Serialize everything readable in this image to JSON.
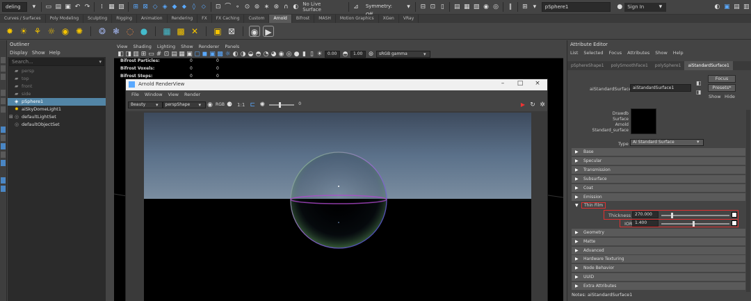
{
  "status_line": {
    "menu_set": "deling",
    "live_surface": "No Live Surface",
    "symmetry": "Symmetry: Off",
    "search_value": "pSphere1",
    "sign_in": "Sign In"
  },
  "shelf_tabs": [
    {
      "label": "Curves / Surfaces",
      "active": false
    },
    {
      "label": "Poly Modeling",
      "active": false
    },
    {
      "label": "Sculpting",
      "active": false
    },
    {
      "label": "Rigging",
      "active": false
    },
    {
      "label": "Animation",
      "active": false
    },
    {
      "label": "Rendering",
      "active": false
    },
    {
      "label": "FX",
      "active": false
    },
    {
      "label": "FX Caching",
      "active": false
    },
    {
      "label": "Custom",
      "active": false
    },
    {
      "label": "Arnold",
      "active": true
    },
    {
      "label": "Bifrost",
      "active": false
    },
    {
      "label": "MASH",
      "active": false
    },
    {
      "label": "Motion Graphics",
      "active": false
    },
    {
      "label": "XGen",
      "active": false
    },
    {
      "label": "VRay",
      "active": false
    }
  ],
  "outliner": {
    "title": "Outliner",
    "menu": [
      "Display",
      "Show",
      "Help"
    ],
    "search_placeholder": "Search...",
    "items": [
      {
        "label": "persp",
        "state": "dim",
        "expander": ""
      },
      {
        "label": "top",
        "state": "dim",
        "expander": ""
      },
      {
        "label": "front",
        "state": "dim",
        "expander": ""
      },
      {
        "label": "side",
        "state": "dim",
        "expander": ""
      },
      {
        "label": "pSphere1",
        "state": "selected",
        "expander": ""
      },
      {
        "label": "aiSkyDomeLight1",
        "state": "lit",
        "expander": ""
      },
      {
        "label": "defaultLightSet",
        "state": "lit",
        "expander": "⊞"
      },
      {
        "label": "defaultObjectSet",
        "state": "lit",
        "expander": ""
      }
    ]
  },
  "viewport": {
    "menu": [
      "View",
      "Shading",
      "Lighting",
      "Show",
      "Renderer",
      "Panels"
    ],
    "exposure": "0.00",
    "gamma": "1.00",
    "color_space": "sRGB gamma",
    "hud": [
      {
        "label": "Bifrost Particles:",
        "v1": "0",
        "v2": "0"
      },
      {
        "label": "Bifrost Voxels:",
        "v1": "0",
        "v2": "0"
      },
      {
        "label": "Bifrost Steps:",
        "v1": "0",
        "v2": "0"
      }
    ]
  },
  "render_view": {
    "title": "Arnold RenderView",
    "menu": [
      "File",
      "Window",
      "View",
      "Render"
    ],
    "aov": "Beauty",
    "camera": "perspShape",
    "ratio": "1:1",
    "exposure": "0"
  },
  "attribute_editor": {
    "title": "Attribute Editor",
    "menu": [
      "List",
      "Selected",
      "Focus",
      "Attributes",
      "Show",
      "Help"
    ],
    "tabs": [
      {
        "label": "pSphereShape1",
        "active": false
      },
      {
        "label": "polySmoothFace1",
        "active": false
      },
      {
        "label": "polySphere1",
        "active": false
      },
      {
        "label": "aiStandardSurface1",
        "active": true
      }
    ],
    "node_type_label": "aiStandardSurface:",
    "node_name": "aiStandardSurface1",
    "focus_button": "Focus",
    "presets_button": "Presets*",
    "show_button": "Show",
    "hide_button": "Hide",
    "swatch_caption": [
      "Drawdb",
      "Surface",
      "Arnold",
      "Standard_surface"
    ],
    "type_label": "Type",
    "type_value": "Ai Standard Surface",
    "sections_top": [
      "Base",
      "Specular",
      "Transmission",
      "Subsurface",
      "Coat",
      "Emission"
    ],
    "thin_film": {
      "label": "Thin Film",
      "thickness_label": "Thickness",
      "thickness_value": "270.000",
      "thickness_fraction": 0.15,
      "ior_label": "IOR",
      "ior_value": "1.400",
      "ior_fraction": 0.47
    },
    "sections_bottom": [
      "Geometry",
      "Matte",
      "Advanced",
      "Hardware Texturing",
      "Node Behavior",
      "UUID",
      "Extra Attributes"
    ],
    "notes": "Notes:  aiStandardSurface1"
  },
  "colors": {
    "accent_blue": "#5285a6",
    "highlight_red": "#e03030",
    "panel": "#444444",
    "dark_panel": "#2b2b2b"
  }
}
